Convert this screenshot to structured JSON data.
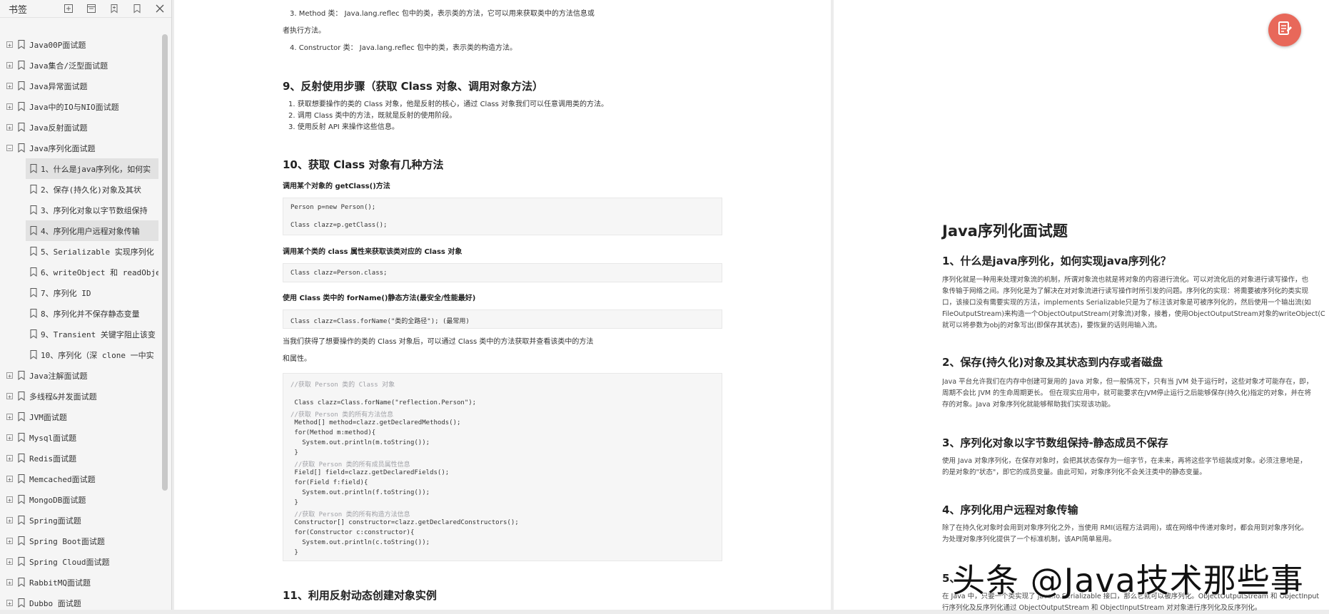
{
  "sidebar": {
    "title": "书签",
    "tools": [
      "expand-all-icon",
      "collapse-all-icon",
      "bookmark-add-icon",
      "bookmark-icon",
      "close-icon"
    ],
    "items": [
      {
        "label": "Java00P面试题",
        "expanded": false
      },
      {
        "label": "Java集合/泛型面试题",
        "expanded": false
      },
      {
        "label": "Java异常面试题",
        "expanded": false
      },
      {
        "label": "Java中的IO与NIO面试题",
        "expanded": false
      },
      {
        "label": "Java反射面试题",
        "expanded": false
      },
      {
        "label": "Java序列化面试题",
        "expanded": true
      }
    ],
    "children": [
      {
        "label": "1、什么是java序列化，如何实",
        "selected": true
      },
      {
        "label": "2、保存(持久化)对象及其状",
        "selected": false
      },
      {
        "label": "3、序列化对象以字节数组保持",
        "selected": false
      },
      {
        "label": "4、序列化用户远程对象传输",
        "selected": true
      },
      {
        "label": "5、Serializable 实现序列化",
        "selected": false
      },
      {
        "label": "6、writeObject 和 readObje",
        "selected": false
      },
      {
        "label": "7、序列化 ID",
        "selected": false
      },
      {
        "label": "8、序列化并不保存静态变量",
        "selected": false
      },
      {
        "label": "9、Transient 关键字阻止该变",
        "selected": false
      },
      {
        "label": "10、序列化（深 clone 一中实",
        "selected": false
      }
    ],
    "items_after": [
      {
        "label": "Java注解面试题"
      },
      {
        "label": "多线程&并发面试题"
      },
      {
        "label": "JVM面试题"
      },
      {
        "label": "Mysql面试题"
      },
      {
        "label": "Redis面试题"
      },
      {
        "label": "Memcached面试题"
      },
      {
        "label": "MongoDB面试题"
      },
      {
        "label": "Spring面试题"
      },
      {
        "label": "Spring Boot面试题"
      },
      {
        "label": "Spring Cloud面试题"
      },
      {
        "label": "RabbitMQ面试题"
      },
      {
        "label": "Dubbo 面试题"
      }
    ]
  },
  "page1": {
    "l1": "3. Method 类： Java.lang.reflec 包中的类，表示类的方法，它可以用来获取类中的方法信息或",
    "l2": "者执行方法。",
    "l3": "4. Constructor 类： Java.lang.reflec 包中的类，表示类的构造方法。",
    "h9": "9、反射使用步骤（获取 Class 对象、调用对象方法）",
    "s1": "1. 获取想要操作的类的 Class 对象，他是反射的核心，通过 Class 对象我们可以任意调用类的方法。",
    "s2": "2. 调用 Class 类中的方法，既就是反射的使用阶段。",
    "s3": "3. 使用反射 API 来操作这些信息。",
    "h10": "10、获取 Class 对象有几种方法",
    "b1": "调用某个对象的 getClass()方法",
    "c1a": "Person p=new Person();",
    "c1b": "Class clazz=p.getClass();",
    "b2": "调用某个类的 class 属性来获取该类对应的 Class 对象",
    "c2": "Class clazz=Person.class;",
    "b3": "使用 Class 类中的 forName()静态方法(最安全/性能最好)",
    "c3": "Class clazz=Class.forName(\"类的全路径\"); (最常用)",
    "p1": "当我们获得了想要操作的类的 Class 对象后，可以通过 Class 类中的方法获取并查看该类中的方法",
    "p2": "和属性。",
    "code": [
      "//获取 Person 类的 Class 对象",
      "",
      " Class clazz=Class.forName(\"reflection.Person\");",
      "//获取 Person 类的所有方法信息",
      " Method[] method=clazz.getDeclaredMethods();",
      " for(Method m:method){",
      "   System.out.println(m.toString());",
      " }",
      " //获取 Person 类的所有成员属性信息",
      " Field[] field=clazz.getDeclaredFields();",
      " for(Field f:field){",
      "   System.out.println(f.toString());",
      " }",
      " //获取 Person 类的所有构造方法信息",
      " Constructor[] constructor=clazz.getDeclaredConstructors();",
      " for(Constructor c:constructor){",
      "   System.out.println(c.toString());",
      " }"
    ],
    "h11": "11、利用反射动态创建对象实例"
  },
  "page2": {
    "title": "Java序列化面试题",
    "s1h": "1、什么是java序列化，如何实现java序列化？",
    "s1p": [
      "序列化就是一种用来处理对象流的机制，所谓对象流也就是将对象的内容进行流化。可以对流化后的对象进行读写操作，也",
      "象传输于网络之间。序列化是为了解决在对对象流进行读写操作时所引发的问题。序列化的实现：将需要被序列化的类实现",
      "口，该接口没有需要实现的方法，implements Serializable只是为了标注该对象是可被序列化的，然后使用一个输出流(如",
      "FileOutputStream)来构造一个ObjectOutputStream(对象流)对象，接着，使用ObjectOutputStream对象的writeObject(C",
      "就可以将参数为obj的对象写出(即保存其状态)，要恢复的话则用输入流。"
    ],
    "s2h": "2、保存(持久化)对象及其状态到内存或者磁盘",
    "s2p": [
      "Java 平台允许我们在内存中创建可复用的 Java 对象，但一般情况下，只有当 JVM 处于运行时，这些对象才可能存在，即，",
      "周期不会比 JVM 的生命周期更长。 但在现实应用中，就可能要求在JVM停止运行之后能够保存(持久化)指定的对象，并在将",
      "存的对象。Java 对象序列化就能够帮助我们实现该功能。"
    ],
    "s3h": "3、序列化对象以字节数组保持-静态成员不保存",
    "s3p": [
      "使用 Java 对象序列化，在保存对象时，会把其状态保存为一组字节，在未来，再将这些字节组装成对象。必须注意地是，",
      "的是对象的\"状态\"，即它的成员变量。由此可知，对象序列化不会关注类中的静态变量。"
    ],
    "s4h": "4、序列化用户远程对象传输",
    "s4p": [
      "除了在持久化对象时会用到对象序列化之外，当使用 RMI(远程方法调用)，或在网络中传递对象时，都会用到对象序列化。",
      "为处理对象序列化提供了一个标准机制，该API简单易用。"
    ],
    "s5h": "5、",
    "s5p": [
      "在 Java 中，只要一个类实现了 java.io.Serializable 接口，那么它就可以被序列化。ObjectOutputStream 和 ObjectInput",
      "行序列化及反序列化通过 ObjectOutputStream 和 ObjectInputStream 对对象进行序列化及反序列化。"
    ]
  },
  "watermark": "头条 @Java技术那些事",
  "colors": {
    "badge": "#e8685a",
    "keyword": "#a626a4",
    "comment": "#a0a1a7",
    "string": "#d84315"
  }
}
